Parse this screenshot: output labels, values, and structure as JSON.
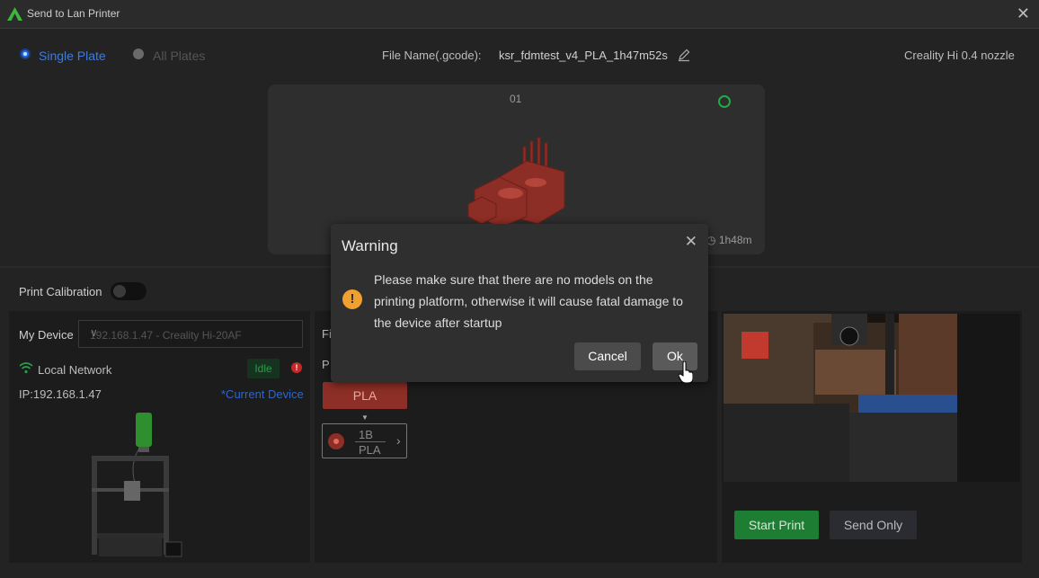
{
  "window": {
    "title": "Send to Lan Printer"
  },
  "header": {
    "single_plate": "Single Plate",
    "all_plates": "All Plates",
    "file_name_label": "File Name(.gcode):",
    "file_name_value": "ksr_fdmtest_v4_PLA_1h47m52s",
    "printer_preset": "Creality Hi 0.4 nozzle"
  },
  "plate": {
    "number": "01",
    "time": "1h48m"
  },
  "calibration": {
    "label": "Print Calibration"
  },
  "device": {
    "label": "My Device",
    "selected": "192.168.1.47 - Creality Hi-20AF",
    "network": "Local Network",
    "status": "Idle",
    "ip": "IP:192.168.1.47",
    "current": "*Current Device"
  },
  "filament": {
    "label_f": "Fi",
    "label_p": "P",
    "chip": "PLA",
    "slot_id": "1B",
    "slot_material": "PLA"
  },
  "actions": {
    "start_print": "Start Print",
    "send_only": "Send Only"
  },
  "dialog": {
    "title": "Warning",
    "message": "Please make sure that there are no models on the printing platform, otherwise it will cause fatal damage to the device after startup",
    "cancel": "Cancel",
    "ok": "Ok"
  },
  "colors": {
    "accent": "#1f6feb",
    "start": "#1d7d33",
    "pla": "#8d2f26",
    "warning": "#f0a030"
  }
}
